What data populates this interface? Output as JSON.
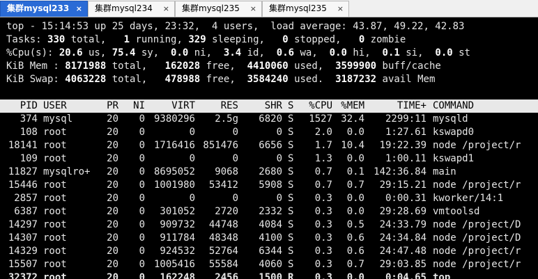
{
  "tabs": [
    {
      "label": "集群mysql233",
      "active": true
    },
    {
      "label": "集群mysql234",
      "active": false
    },
    {
      "label": "集群mysql235",
      "active": false
    },
    {
      "label": "集群mysql235",
      "active": false
    }
  ],
  "tab_close_glyph": "×",
  "summary": {
    "line1": "top - 15:14:53 up 25 days, 23:32,  4 users,  load average: 43.87, 49.22, 42.83",
    "tasks": {
      "prefix": "Tasks: ",
      "total": "330",
      "t_total": " total,   ",
      "running": "1",
      "t_running": " running, ",
      "sleeping": "329",
      "t_sleeping": " sleeping,   ",
      "stopped": "0",
      "t_stopped": " stopped,   ",
      "zombie": "0",
      "t_zombie": " zombie"
    },
    "cpu": {
      "prefix": "%Cpu(s): ",
      "us": "20.6",
      "t_us": " us, ",
      "sy": "75.4",
      "t_sy": " sy,  ",
      "ni": "0.0",
      "t_ni": " ni,  ",
      "id": "3.4",
      "t_id": " id,  ",
      "wa": "0.6",
      "t_wa": " wa,  ",
      "hi": "0.0",
      "t_hi": " hi,  ",
      "si": "0.1",
      "t_si": " si,  ",
      "st": "0.0",
      "t_st": " st"
    },
    "mem": {
      "prefix": "KiB Mem : ",
      "total": "8171988",
      "t_total": " total,   ",
      "free": "162028",
      "t_free": " free,  ",
      "used": "4410060",
      "t_used": " used,  ",
      "buff": "3599900",
      "t_buff": " buff/cache"
    },
    "swap": {
      "prefix": "KiB Swap: ",
      "total": "4063228",
      "t_total": " total,   ",
      "free": "478988",
      "t_free": " free,  ",
      "used": "3584240",
      "t_used": " used.  ",
      "avail": "3187232",
      "t_avail": " avail Mem"
    }
  },
  "columns": [
    "PID",
    "USER",
    "PR",
    "NI",
    "VIRT",
    "RES",
    "SHR",
    "S",
    "%CPU",
    "%MEM",
    "TIME+",
    "COMMAND"
  ],
  "processes": [
    [
      "374",
      "mysql",
      "20",
      "0",
      "9380296",
      "2.5g",
      "6820",
      "S",
      "1527",
      "32.4",
      "2299:11",
      "mysqld"
    ],
    [
      "108",
      "root",
      "20",
      "0",
      "0",
      "0",
      "0",
      "S",
      "2.0",
      "0.0",
      "1:27.61",
      "kswapd0"
    ],
    [
      "18141",
      "root",
      "20",
      "0",
      "1716416",
      "851476",
      "6656",
      "S",
      "1.7",
      "10.4",
      "19:22.39",
      "node /project/r"
    ],
    [
      "109",
      "root",
      "20",
      "0",
      "0",
      "0",
      "0",
      "S",
      "1.3",
      "0.0",
      "1:00.11",
      "kswapd1"
    ],
    [
      "11827",
      "mysqlro+",
      "20",
      "0",
      "8695052",
      "9068",
      "2680",
      "S",
      "0.7",
      "0.1",
      "142:36.84",
      "main"
    ],
    [
      "15446",
      "root",
      "20",
      "0",
      "1001980",
      "53412",
      "5908",
      "S",
      "0.7",
      "0.7",
      "29:15.21",
      "node /project/r"
    ],
    [
      "2857",
      "root",
      "20",
      "0",
      "0",
      "0",
      "0",
      "S",
      "0.3",
      "0.0",
      "0:00.31",
      "kworker/14:1"
    ],
    [
      "6387",
      "root",
      "20",
      "0",
      "301052",
      "2720",
      "2332",
      "S",
      "0.3",
      "0.0",
      "29:28.69",
      "vmtoolsd"
    ],
    [
      "14297",
      "root",
      "20",
      "0",
      "909732",
      "44748",
      "4084",
      "S",
      "0.3",
      "0.5",
      "24:33.79",
      "node /project/D"
    ],
    [
      "14307",
      "root",
      "20",
      "0",
      "911784",
      "48348",
      "4100",
      "S",
      "0.3",
      "0.6",
      "24:34.84",
      "node /project/D"
    ],
    [
      "14329",
      "root",
      "20",
      "0",
      "924532",
      "52764",
      "6344",
      "S",
      "0.3",
      "0.6",
      "24:47.48",
      "node /project/r"
    ],
    [
      "15507",
      "root",
      "20",
      "0",
      "1005416",
      "55584",
      "4060",
      "S",
      "0.3",
      "0.7",
      "29:03.85",
      "node /project/r"
    ],
    [
      "32372",
      "root",
      "20",
      "0",
      "162248",
      "2456",
      "1500",
      "R",
      "0.3",
      "0.0",
      "0:04.65",
      "top"
    ]
  ]
}
